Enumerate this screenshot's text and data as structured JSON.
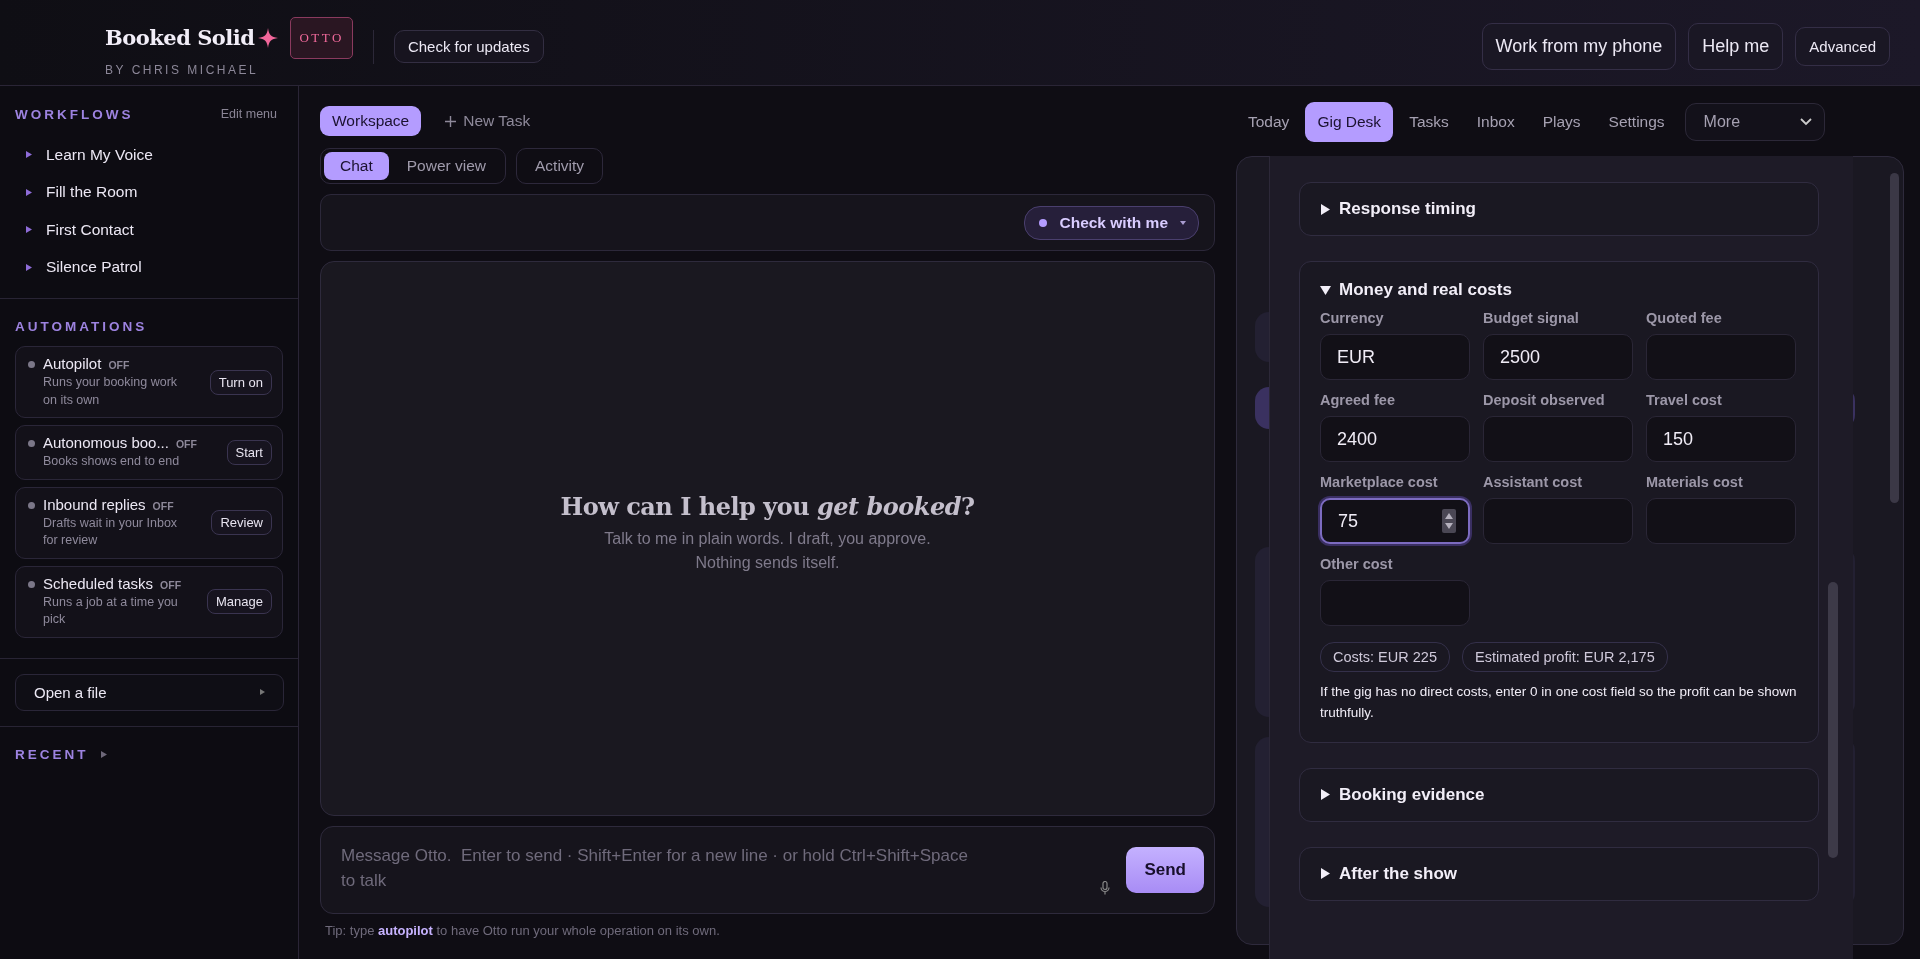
{
  "header": {
    "brand": {
      "title": "Booked Solid",
      "byline": "BY CHRIS MICHAEL",
      "badge": "OTTO"
    },
    "update_button": "Check for updates",
    "actions": [
      {
        "label": "Work from my phone",
        "kind": "large"
      },
      {
        "label": "Help me",
        "kind": "large"
      },
      {
        "label": "Advanced",
        "kind": "small"
      }
    ]
  },
  "sidebar": {
    "workflows": {
      "title": "WORKFLOWS",
      "edit_label": "Edit menu",
      "items": [
        "Learn My Voice",
        "Fill the Room",
        "First Contact",
        "Silence Patrol"
      ]
    },
    "automations": {
      "title": "AUTOMATIONS",
      "items": [
        {
          "name": "Autopilot",
          "status": "OFF",
          "description": "Runs your booking work on its own",
          "action": "Turn on"
        },
        {
          "name": "Autonomous boo...",
          "status": "OFF",
          "description": "Books shows end to end",
          "action": "Start"
        },
        {
          "name": "Inbound replies",
          "status": "OFF",
          "description": "Drafts wait in your Inbox for review",
          "action": "Review"
        },
        {
          "name": "Scheduled tasks",
          "status": "OFF",
          "description": "Runs a job at a time you pick",
          "action": "Manage"
        }
      ]
    },
    "open_file": "Open a file",
    "recent": "RECENT"
  },
  "workspace": {
    "top_tabs": [
      {
        "label": "Workspace",
        "selected": true
      }
    ],
    "new_task": "New Task",
    "view_switcher": [
      {
        "label": "Chat",
        "selected": true
      },
      {
        "label": "Power view",
        "selected": false
      }
    ],
    "activity_tab": {
      "label": "Activity",
      "selected": false
    },
    "mode_button": "Check with me",
    "empty_state": {
      "heading": "How can I help you *get booked*?",
      "lines": [
        "Talk to me in plain words. I draft, you approve.",
        "Nothing sends itself."
      ]
    },
    "composer": {
      "placeholder": "Message Otto.  Enter to send · Shift+Enter for a new line · or hold Ctrl+Shift+Space to talk",
      "send": "Send"
    },
    "tip": "Tip: type **autopilot** to have Otto run your whole operation on its own."
  },
  "gig_desk": {
    "tabs": [
      {
        "label": "Today",
        "selected": false
      },
      {
        "label": "Gig Desk",
        "selected": true
      },
      {
        "label": "Tasks",
        "selected": false
      },
      {
        "label": "Inbox",
        "selected": false
      },
      {
        "label": "Plays",
        "selected": false
      },
      {
        "label": "Settings",
        "selected": false
      }
    ],
    "more_select": "More",
    "sections": [
      {
        "title": "Response timing",
        "expanded": false
      },
      {
        "title": "Money and real costs",
        "expanded": true,
        "fields": [
          {
            "label": "Currency",
            "value": "EUR",
            "focused": false
          },
          {
            "label": "Budget signal",
            "value": "2500",
            "focused": false
          },
          {
            "label": "Quoted fee",
            "focused": false
          },
          {
            "label": "Agreed fee",
            "value": "2400",
            "focused": false
          },
          {
            "label": "Deposit observed",
            "focused": false
          },
          {
            "label": "Travel cost",
            "value": "150",
            "focused": false
          },
          {
            "label": "Marketplace cost",
            "value": "75",
            "focused": true
          },
          {
            "label": "Assistant cost",
            "focused": false
          },
          {
            "label": "Materials cost",
            "focused": false
          },
          {
            "label": "Other cost",
            "focused": false
          }
        ],
        "totals": [
          "Costs: EUR 225",
          "Estimated profit: EUR 2,175"
        ],
        "note": "If the gig has no direct costs, enter 0 in one cost field so the profit can be shown truthfully."
      },
      {
        "title": "Booking evidence",
        "expanded": false
      },
      {
        "title": "After the show",
        "expanded": false
      }
    ]
  }
}
